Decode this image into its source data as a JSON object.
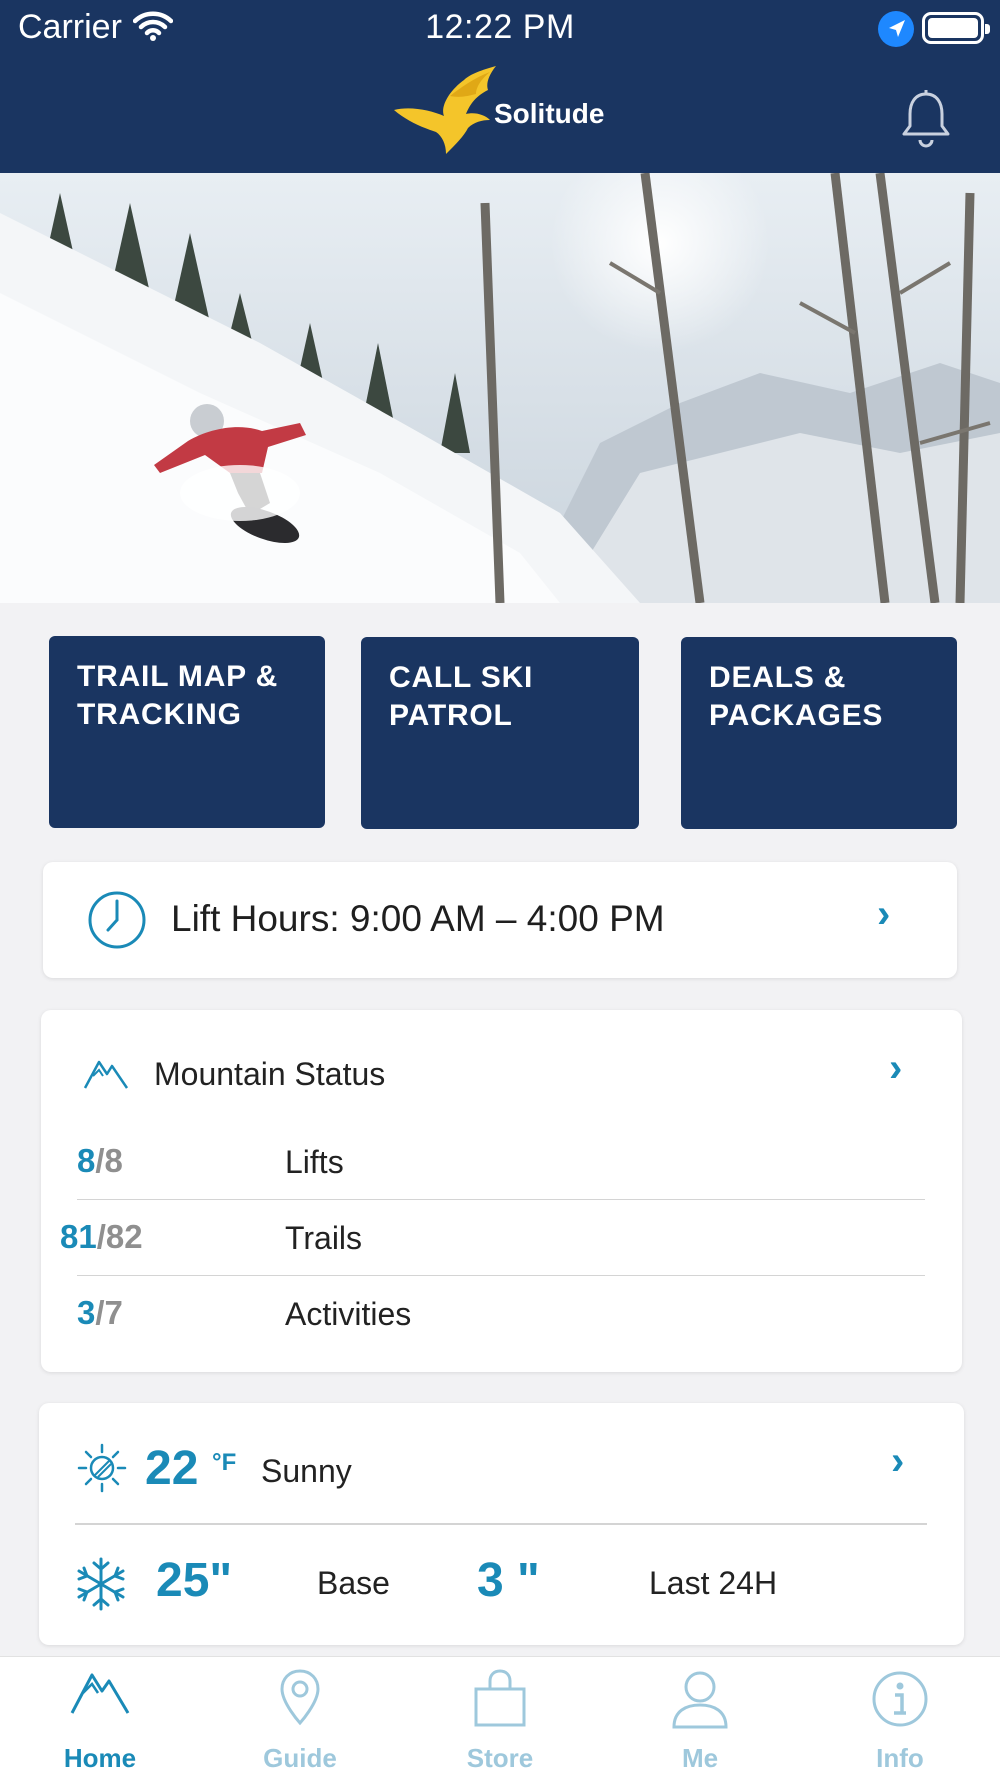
{
  "status_bar": {
    "carrier": "Carrier",
    "time": "12:22 PM"
  },
  "header": {
    "logo_text": "Solitude",
    "logo_color": "#f4c52a",
    "background": "#1a3561"
  },
  "hero": {
    "icon": "snowboarder-photo"
  },
  "quick_actions": [
    {
      "line1": "TRAIL MAP &",
      "line2": "TRACKING"
    },
    {
      "line1": "CALL SKI",
      "line2": "PATROL"
    },
    {
      "line1": "DEALS &",
      "line2": "PACKAGES"
    }
  ],
  "lift_hours": {
    "label": "Lift Hours: 9:00 AM – 4:00 PM"
  },
  "mountain_status": {
    "title": "Mountain Status",
    "rows": [
      {
        "open": "8",
        "total": "/8",
        "label": "Lifts"
      },
      {
        "open": "81",
        "total": "/82",
        "label": "Trails"
      },
      {
        "open": "3",
        "total": "/7",
        "label": "Activities"
      }
    ]
  },
  "weather": {
    "temperature": "22",
    "unit": "°F",
    "condition": "Sunny",
    "base_depth": "25\"",
    "base_label": "Base",
    "new_snow": "3 \"",
    "new_snow_label": "Last 24H"
  },
  "tabs": [
    {
      "label": "Home",
      "icon": "mountain-icon",
      "active": true
    },
    {
      "label": "Guide",
      "icon": "map-pin-icon"
    },
    {
      "label": "Store",
      "icon": "shopping-bag-icon"
    },
    {
      "label": "Me",
      "icon": "person-icon"
    },
    {
      "label": "Info",
      "icon": "info-icon"
    }
  ],
  "colors": {
    "accent": "#1a8ab7",
    "navy": "#1a3561",
    "tab_inactive": "#9ec8dc"
  }
}
